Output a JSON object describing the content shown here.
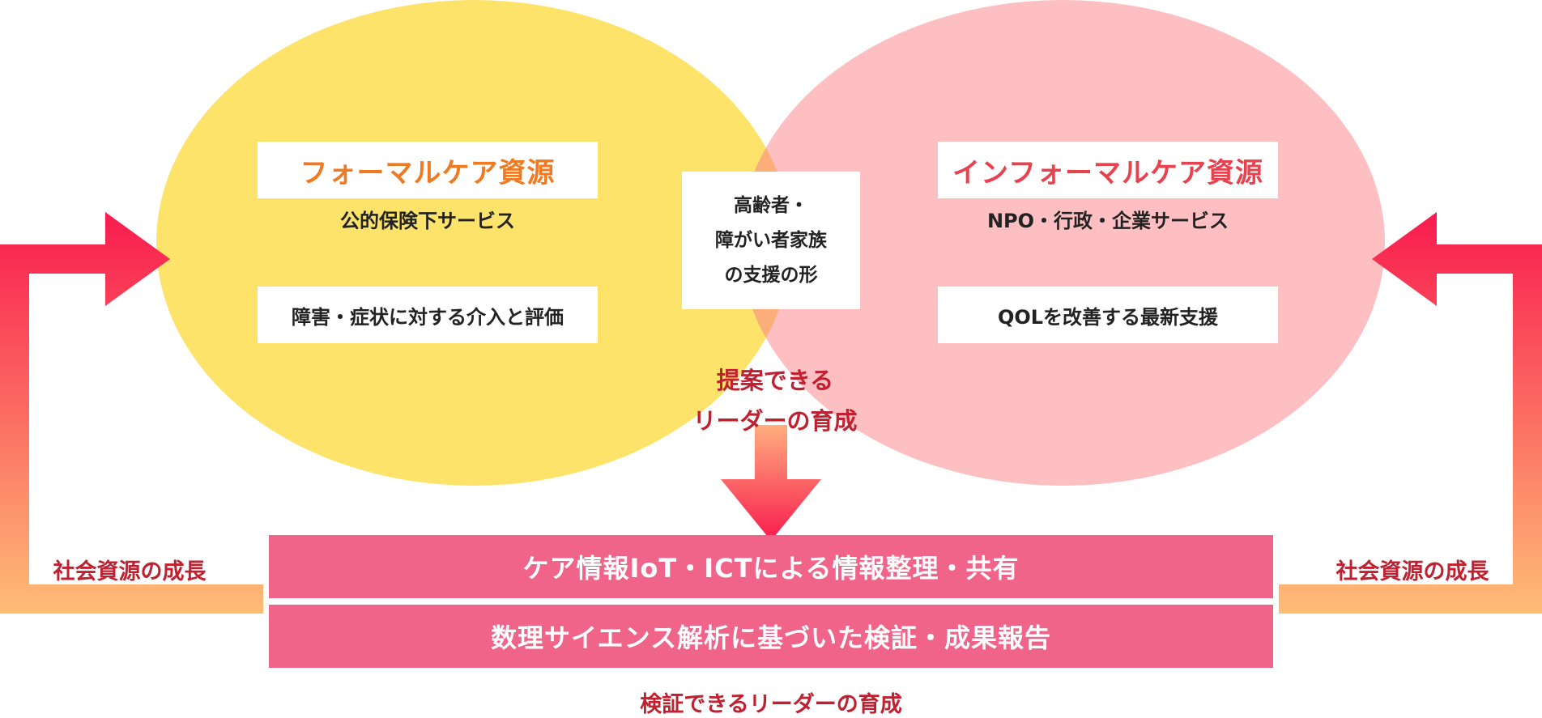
{
  "colors": {
    "formal_circle": "#fde36a",
    "informal_circle": "#fdbfc2",
    "overlap": "#fcae7a",
    "band": "#f0648a",
    "arrow_top": "#f81b4e",
    "arrow_bottom": "#ffbd77",
    "accent_red": "#c0202f",
    "formal_title": "#f07a22",
    "informal_title": "#e8424f"
  },
  "formal": {
    "title": "フォーマルケア資源",
    "subtitle": "公的保険下サービス",
    "item": "障害・症状に対する介入と評価"
  },
  "informal": {
    "title": "インフォーマルケア資源",
    "subtitle": "NPO・行政・企業サービス",
    "item": "QOLを改善する最新支援"
  },
  "center": {
    "lines": [
      "高齢者・",
      "障がい者家族",
      "の支援の形"
    ]
  },
  "proposal": {
    "lines": [
      "提案できる",
      "リーダーの育成"
    ]
  },
  "bands": {
    "band1": "ケア情報IoT・ICTによる情報整理・共有",
    "band2": "数理サイエンス解析に基づいた検証・成果報告"
  },
  "growth": {
    "left": "社会資源の成長",
    "right": "社会資源の成長"
  },
  "bottom_caption": "検証できるリーダーの育成"
}
